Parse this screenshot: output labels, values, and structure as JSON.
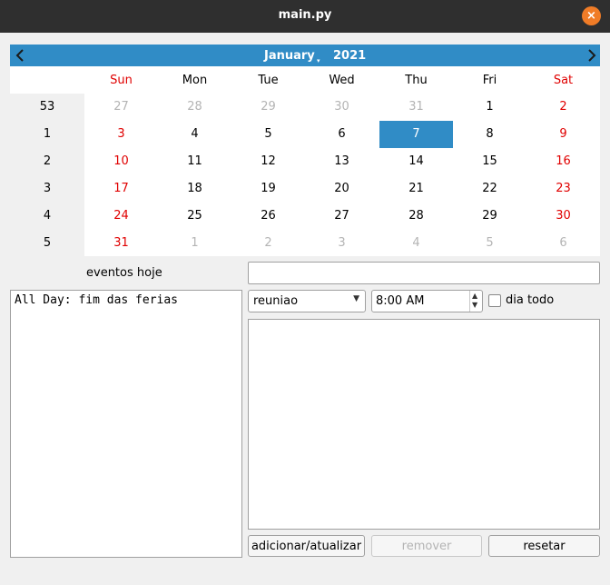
{
  "window": {
    "title": "main.py",
    "close_icon": "close-icon",
    "close_glyph": "×"
  },
  "calendar": {
    "month": "January",
    "year": "2021",
    "month_caret": "▾",
    "prev_icon": "chevron-left-icon",
    "next_icon": "chevron-right-icon",
    "selected_day": "7",
    "weekday_headers": [
      "Sun",
      "Mon",
      "Tue",
      "Wed",
      "Thu",
      "Fri",
      "Sat"
    ],
    "week_numbers": [
      "53",
      "1",
      "2",
      "3",
      "4",
      "5"
    ],
    "weeks": [
      [
        "27",
        "28",
        "29",
        "30",
        "31",
        "1",
        "2"
      ],
      [
        "3",
        "4",
        "5",
        "6",
        "7",
        "8",
        "9"
      ],
      [
        "10",
        "11",
        "12",
        "13",
        "14",
        "15",
        "16"
      ],
      [
        "17",
        "18",
        "19",
        "20",
        "21",
        "22",
        "23"
      ],
      [
        "24",
        "25",
        "26",
        "27",
        "28",
        "29",
        "30"
      ],
      [
        "31",
        "1",
        "2",
        "3",
        "4",
        "5",
        "6"
      ]
    ],
    "colors": {
      "header_bg": "#308cc6",
      "weekend": "#e00000",
      "other_month": "#b4b4b4",
      "selected_bg": "#308cc6"
    }
  },
  "events": {
    "label": "eventos hoje",
    "items": [
      "All Day: fim das ferias"
    ]
  },
  "form": {
    "title_value": "",
    "type_value": "reuniao",
    "time_value": "8:00 AM",
    "all_day_label": "dia todo",
    "all_day_checked": false,
    "description_value": ""
  },
  "buttons": {
    "add_update": "adicionar/atualizar",
    "remove": "remover",
    "reset": "resetar"
  }
}
